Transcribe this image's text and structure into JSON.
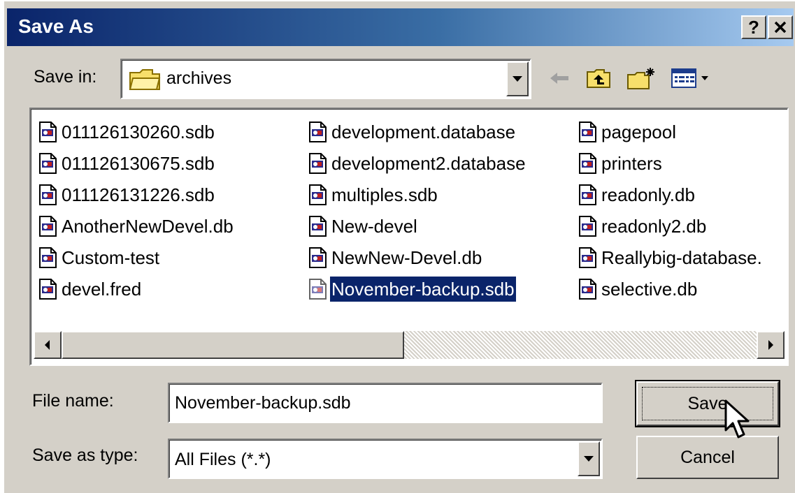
{
  "window": {
    "title": "Save As",
    "help_label": "?",
    "close_label": "✕"
  },
  "save_in": {
    "label": "Save in:",
    "value": "archives"
  },
  "toolbar": {
    "back_icon": "back-arrow-icon",
    "up_icon": "up-folder-icon",
    "new_folder_icon": "new-folder-icon",
    "view_icon": "view-menu-icon"
  },
  "files": {
    "columns": [
      [
        "011126130260.sdb",
        "011126130675.sdb",
        "011126131226.sdb",
        "AnotherNewDevel.db",
        "Custom-test",
        "devel.fred"
      ],
      [
        "development.database",
        "development2.database",
        "multiples.sdb",
        "New-devel",
        "NewNew-Devel.db",
        "November-backup.sdb"
      ],
      [
        "pagepool",
        "printers",
        "readonly.db",
        "readonly2.db",
        "Reallybig-database.",
        "selective.db"
      ]
    ],
    "selected": "November-backup.sdb"
  },
  "file_name": {
    "label": "File name:",
    "value": "November-backup.sdb"
  },
  "save_as_type": {
    "label": "Save as type:",
    "value": "All Files (*.*)"
  },
  "buttons": {
    "save": "Save",
    "cancel": "Cancel"
  },
  "colors": {
    "selection": "#0a246a",
    "title_start": "#0a246a",
    "title_end": "#a6caf0",
    "face": "#d4d0c8"
  }
}
